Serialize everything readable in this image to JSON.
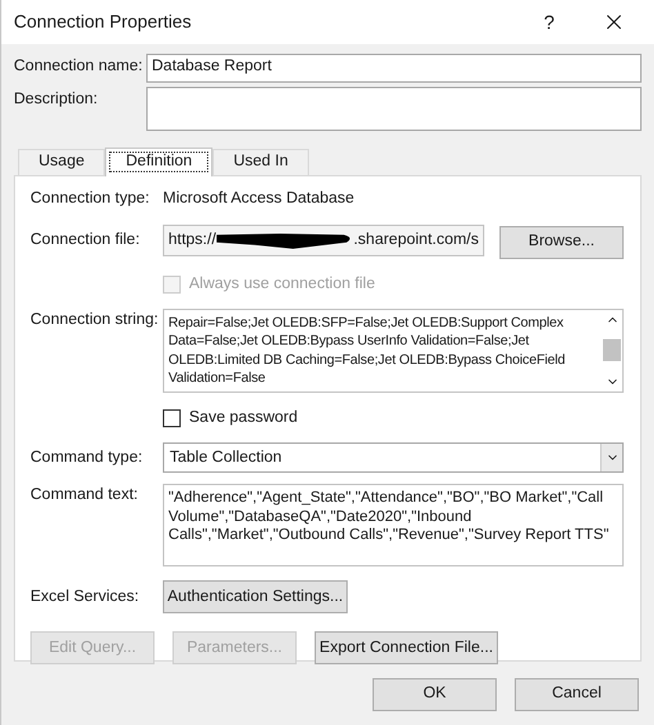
{
  "window": {
    "title": "Connection Properties",
    "help": "?"
  },
  "connection_name": {
    "label": "Connection name:",
    "value": "Database Report"
  },
  "description": {
    "label": "Description:"
  },
  "tabs": [
    {
      "label": "Usage",
      "selected": false
    },
    {
      "label": "Definition",
      "selected": true
    },
    {
      "label": "Used In",
      "selected": false
    }
  ],
  "definition": {
    "connection_type": {
      "label": "Connection type:",
      "value": "Microsoft Access Database"
    },
    "connection_file": {
      "label": "Connection file:",
      "value_start": "https://",
      "value_end": ".sharepoint.com/s",
      "button": "Browse..."
    },
    "always_use_file": {
      "label": "Always use connection file",
      "checked": false,
      "disabled": true
    },
    "connection_string": {
      "label": "Connection string:",
      "lines": [
        "Repair=False;Jet OLEDB:SFP=False;Jet OLEDB:Support Complex",
        "Data=False;Jet OLEDB:Bypass UserInfo Validation=False;Jet",
        "OLEDB:Limited DB Caching=False;Jet OLEDB:Bypass ChoiceField",
        "Validation=False"
      ]
    },
    "save_password": {
      "label": "Save password",
      "checked": false,
      "disabled": false
    },
    "command_type": {
      "label": "Command type:",
      "value": "Table Collection"
    },
    "command_text": {
      "label": "Command text:",
      "lines": [
        "\"Adherence\",\"Agent_State\",\"Attendance\",\"BO\",\"BO Market\",\"Call",
        "Volume\",\"DatabaseQA\",\"Date2020\",\"Inbound",
        "Calls\",\"Market\",\"Outbound Calls\",\"Revenue\",\"Survey Report TTS\""
      ]
    },
    "excel_services": {
      "label": "Excel Services:",
      "button": "Authentication Settings..."
    },
    "actions": [
      {
        "label": "Edit Query...",
        "disabled": true
      },
      {
        "label": "Parameters...",
        "disabled": true
      },
      {
        "label": "Export Connection File...",
        "disabled": false
      }
    ]
  },
  "buttons": [
    "OK",
    "Cancel"
  ]
}
